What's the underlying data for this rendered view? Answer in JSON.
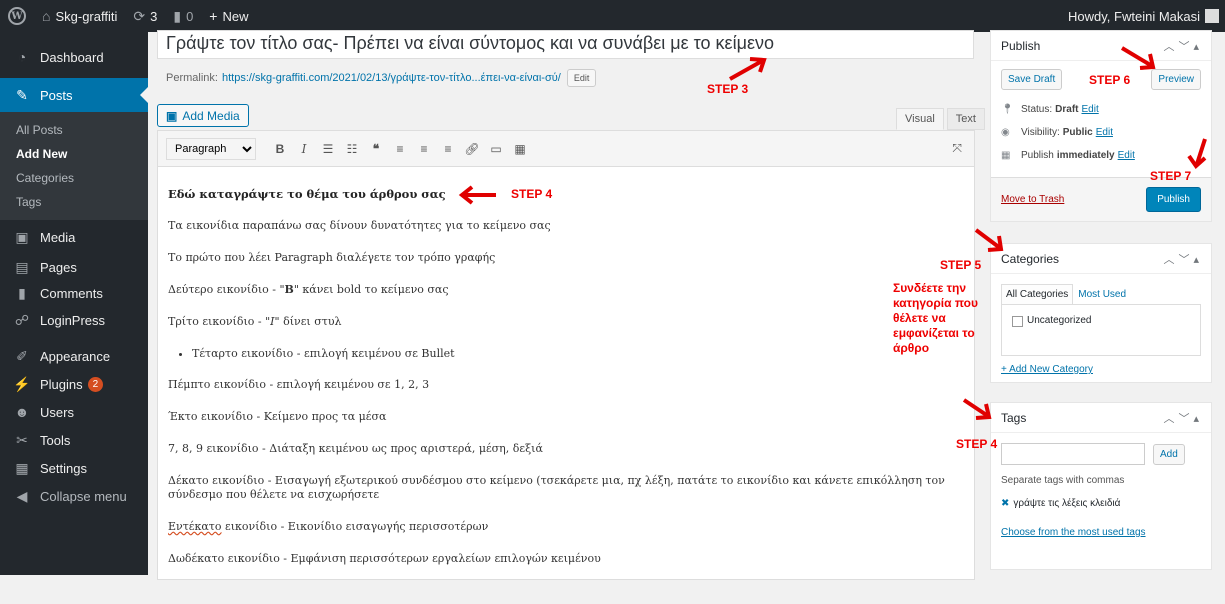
{
  "adminbar": {
    "site_name": "Skg-graffiti",
    "updates_count": "3",
    "comments_count": "0",
    "new_label": "New",
    "howdy": "Howdy, Fwteini Makasi"
  },
  "sidebar": {
    "items": [
      {
        "label": "Dashboard",
        "icon": "dashboard-icon"
      },
      {
        "label": "Posts",
        "icon": "pin-icon"
      },
      {
        "label": "Media",
        "icon": "media-icon"
      },
      {
        "label": "Pages",
        "icon": "pages-icon"
      },
      {
        "label": "Comments",
        "icon": "comments-icon"
      },
      {
        "label": "LoginPress",
        "icon": "loginpress-icon"
      },
      {
        "label": "Appearance",
        "icon": "brush-icon"
      },
      {
        "label": "Plugins",
        "icon": "plug-icon",
        "badge": "2"
      },
      {
        "label": "Users",
        "icon": "users-icon"
      },
      {
        "label": "Tools",
        "icon": "wrench-icon"
      },
      {
        "label": "Settings",
        "icon": "settings-icon"
      },
      {
        "label": "Collapse menu",
        "icon": "collapse-icon"
      }
    ],
    "posts_submenu": [
      "All Posts",
      "Add New",
      "Categories",
      "Tags"
    ]
  },
  "editor": {
    "title": "Γράψτε τον τίτλο σας- Πρέπει να είναι σύντομος και να συνάβει με το κείμενο",
    "permalink_label": "Permalink:",
    "permalink_url": "https://skg-graffiti.com/2021/02/13/γράψτε-τον-τίτλο...έπει-να-είναι-σύ/",
    "permalink_edit": "Edit",
    "add_media": "Add Media",
    "tab_visual": "Visual",
    "tab_text": "Text",
    "format_select": "Paragraph",
    "content": {
      "heading": "Εδώ καταγράψτε το θέμα του άρθρου σας",
      "p1": "Τα εικονίδια παραπάνω σας δίνουν δυνατότητες για το κείμενο σας",
      "p2": "Το πρώτο που λέει Paragraph διαλέγετε τον τρόπο γραφής",
      "p3_pre": "Δεύτερο εικονίδιο - \"",
      "p3_bold": "B",
      "p3_post": "\" κάνει bold το κείμενο σας",
      "p4_pre": "Τρίτο εικονίδιο - \"",
      "p4_italic": "I",
      "p4_post": "\" δίνει στυλ",
      "bullet": "Τέταρτο εικονίδιο - επιλογή κειμένου σε Bullet",
      "p5": "Πέμπτο εικονίδιο - επιλογή κειμένου σε 1, 2, 3",
      "p6": "Έκτο εικονίδιο - Κείμενο προς τα μέσα",
      "p7": "7, 8, 9 εικονίδιο - Διάταξη κειμένου ως προς αριστερά, μέση, δεξιά",
      "p8": "Δέκατο εικονίδιο - Εισαγωγή εξωτερικού συνδέσμου στο κείμενο (τσεκάρετε μια, πχ λέξη, πατάτε το εικονίδιο και κάνετε επικόλληση τον σύνδεσμο που θέλετε να εισχωρήσετε",
      "p9_spell": "Εντέκατο",
      "p9_rest": " εικονίδιο - Εικονίδιο εισαγωγής περισσοτέρων",
      "p10": "Δωδέκατο εικονίδιο - Εμφάνιση περισσότερων εργαλείων επιλογών κειμένου"
    }
  },
  "publish": {
    "title": "Publish",
    "save_draft": "Save Draft",
    "preview": "Preview",
    "status_label": "Status:",
    "status_value": "Draft",
    "visibility_label": "Visibility:",
    "visibility_value": "Public",
    "publish_label": "Publish",
    "publish_value": "immediately",
    "edit": "Edit",
    "trash": "Move to Trash",
    "publish_button": "Publish"
  },
  "categories": {
    "title": "Categories",
    "tab_all": "All Categories",
    "tab_used": "Most Used",
    "item": "Uncategorized",
    "add_new": "+ Add New Category"
  },
  "tags": {
    "title": "Tags",
    "add": "Add",
    "hint": "Separate tags with commas",
    "tag": "γράψτε τις λέξεις κλειδιά",
    "choose": "Choose from the most used tags"
  },
  "annotations": {
    "step3": "STEP 3",
    "step4a": "STEP 4",
    "step4b": "STEP 4",
    "step5": "STEP 5",
    "step5_text": "Συνδέετε την κατηγορία που θέλετε να εμφανίζεται το άρθρο",
    "step6": "STEP 6",
    "step7": "STEP 7",
    "color": "#e00000"
  }
}
